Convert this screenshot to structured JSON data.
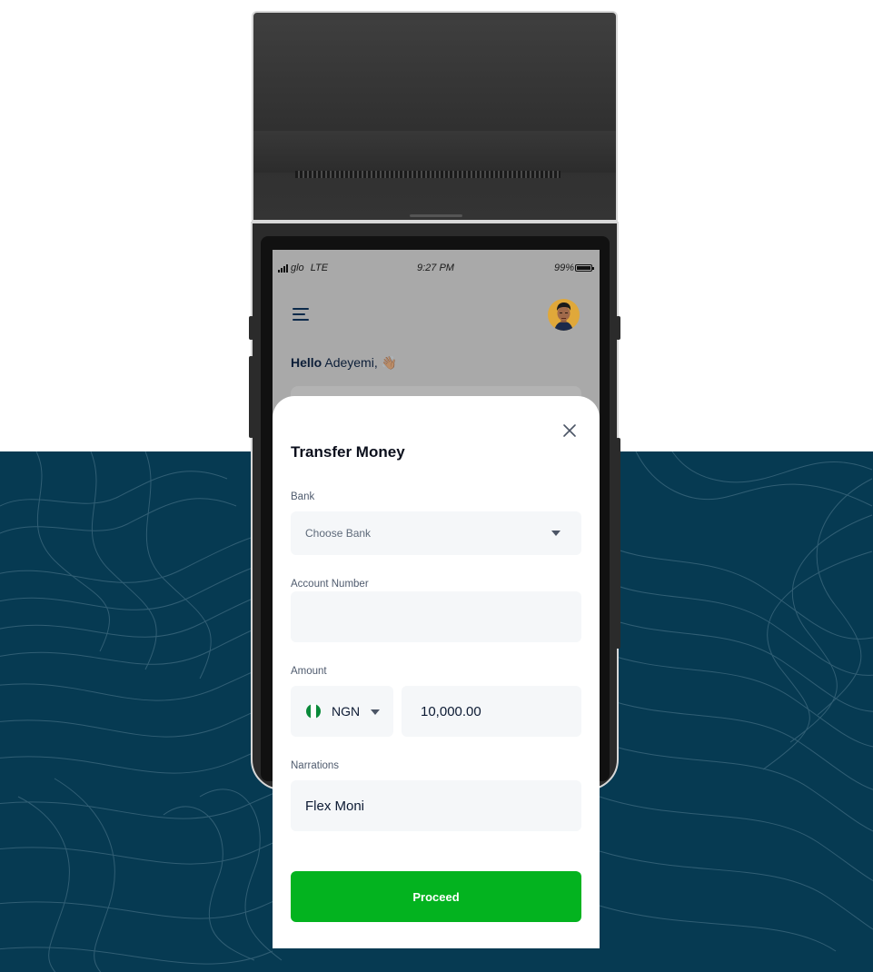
{
  "colors": {
    "background_top": "#ffffff",
    "background_bottom": "#063a52",
    "accent_green": "#03b31f",
    "navy_text": "#0c1e38",
    "field_bg": "#f5f7f9"
  },
  "status_bar": {
    "carrier": "glo",
    "network": "LTE",
    "time": "9:27 PM",
    "battery": "99%"
  },
  "header": {
    "menu_icon": "hamburger-menu-icon",
    "avatar_icon": "user-avatar"
  },
  "greeting": {
    "hello": "Hello",
    "name": "Adeyemi,",
    "emoji": "👋🏽"
  },
  "transfer_sheet": {
    "title": "Transfer Money",
    "close_icon": "close-icon",
    "bank": {
      "label": "Bank",
      "placeholder": "Choose Bank"
    },
    "account_number": {
      "label": "Account Number",
      "value": ""
    },
    "amount": {
      "label": "Amount",
      "currency": "NGN",
      "currency_flag": "nigeria-flag-icon",
      "value": "10,000.00"
    },
    "narrations": {
      "label": "Narrations",
      "value": "Flex Moni"
    },
    "proceed_label": "Proceed"
  }
}
